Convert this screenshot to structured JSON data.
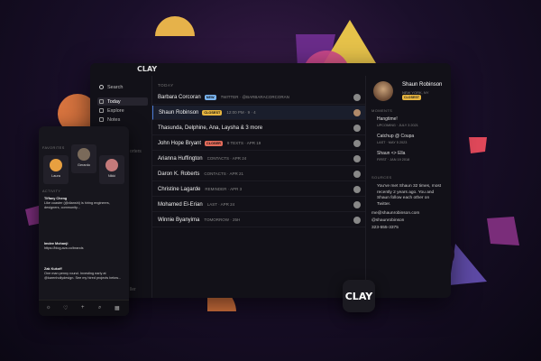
{
  "app": {
    "title": "CLAY"
  },
  "sidebar": {
    "search": "Search",
    "items": [
      {
        "label": "Today"
      },
      {
        "label": "Explore"
      },
      {
        "label": "Notes"
      }
    ]
  },
  "main": {
    "section_label": "TODAY",
    "rows": [
      {
        "name": "Barbara Corcoran",
        "badge": "NEW",
        "meta": "TWITTER · @BARBARACORCORAN"
      },
      {
        "name": "Shaun Robinson",
        "badge": "CLOSEST",
        "meta": "12:00 PM · 9 · 4"
      },
      {
        "name": "Thasunda, Delphine, Ana, Laysha & 3 more",
        "badge": "",
        "meta": ""
      },
      {
        "name": "John Hope Bryant",
        "badge": "CLOSER",
        "meta": "9 TEXTS · APR 19"
      },
      {
        "name": "Arianna Huffington",
        "badge": "",
        "meta": "CONTACTS · APR 24"
      },
      {
        "name": "Daron K. Roberts",
        "badge": "",
        "meta": "CONTACTS · APR 21"
      },
      {
        "name": "Christine Lagarde",
        "badge": "",
        "meta": "REMINDER · APR 3"
      },
      {
        "name": "Mohamed El-Erian",
        "badge": "",
        "meta": "LAST · APR 24"
      },
      {
        "name": "Winnie Byanyima",
        "badge": "",
        "meta": "TOMORROW · 25H"
      }
    ]
  },
  "detail": {
    "name": "Shaun Robinson",
    "location": "NEW YORK, NY",
    "badge": "CLOSEST",
    "moments_label": "MOMENTS",
    "moments": [
      {
        "title": "Hangtime!",
        "sub": "UPCOMING · JULY 3 2021"
      },
      {
        "title": "Catchup @ Coupa",
        "sub": "LAST · MAY 5 2023"
      },
      {
        "title": "Shaun <> Ella",
        "sub": "FIRST · JAN 19 2018"
      }
    ],
    "sources_label": "SOURCES",
    "summary": "You've met Shaun 32 times, most recently 2 years ago. You and Shaun follow each other on Twitter.",
    "email": "me@shaunrobinson.com",
    "twitter": "@shaunrobinson",
    "phone": "323-555-3375"
  },
  "phone_app": {
    "favorites_label": "FAVORITES",
    "favorites": [
      {
        "name": "Laura"
      },
      {
        "name": "Gerardo"
      },
      {
        "name": "Nikki"
      }
    ],
    "activity_label": "ACTIVITY",
    "activity": [
      {
        "who": "Tiffany Cheng",
        "text": "Like coaster (@dianshi) is hiring engineers, designers, community..."
      },
      {
        "who": "Imdee Mohanji",
        "text": "https://blog.ava.co/brands"
      },
      {
        "who": "Zak Kukoff",
        "text": "One man penny round. Investing early at @karenhollydesign. See my hired projects below..."
      }
    ]
  },
  "logo": "CLAY",
  "cut_off": {
    "left_text": "orters",
    "bottom_text": "ller"
  }
}
